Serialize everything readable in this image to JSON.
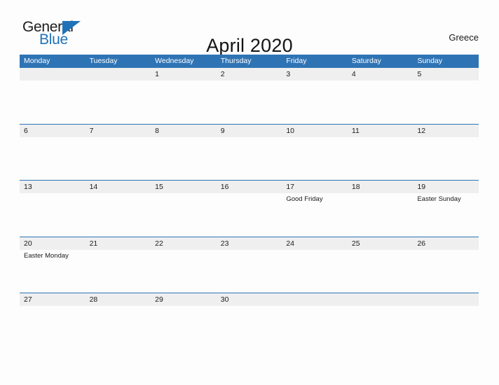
{
  "logo": {
    "word_one": "General",
    "word_two": "Blue",
    "triangle_icon": "triangle-icon",
    "accent_color": "#2072b8"
  },
  "header": {
    "title": "April 2020",
    "country": "Greece"
  },
  "theme": {
    "header_blue": "#2e74b5",
    "band_gray": "#efefef",
    "page_background": "#fdfdfd"
  },
  "calendar": {
    "weekdays": [
      "Monday",
      "Tuesday",
      "Wednesday",
      "Thursday",
      "Friday",
      "Saturday",
      "Sunday"
    ],
    "weeks": [
      [
        {
          "day": "",
          "event": ""
        },
        {
          "day": "",
          "event": ""
        },
        {
          "day": "1",
          "event": ""
        },
        {
          "day": "2",
          "event": ""
        },
        {
          "day": "3",
          "event": ""
        },
        {
          "day": "4",
          "event": ""
        },
        {
          "day": "5",
          "event": ""
        }
      ],
      [
        {
          "day": "6",
          "event": ""
        },
        {
          "day": "7",
          "event": ""
        },
        {
          "day": "8",
          "event": ""
        },
        {
          "day": "9",
          "event": ""
        },
        {
          "day": "10",
          "event": ""
        },
        {
          "day": "11",
          "event": ""
        },
        {
          "day": "12",
          "event": ""
        }
      ],
      [
        {
          "day": "13",
          "event": ""
        },
        {
          "day": "14",
          "event": ""
        },
        {
          "day": "15",
          "event": ""
        },
        {
          "day": "16",
          "event": ""
        },
        {
          "day": "17",
          "event": "Good Friday"
        },
        {
          "day": "18",
          "event": ""
        },
        {
          "day": "19",
          "event": "Easter Sunday"
        }
      ],
      [
        {
          "day": "20",
          "event": "Easter Monday"
        },
        {
          "day": "21",
          "event": ""
        },
        {
          "day": "22",
          "event": ""
        },
        {
          "day": "23",
          "event": ""
        },
        {
          "day": "24",
          "event": ""
        },
        {
          "day": "25",
          "event": ""
        },
        {
          "day": "26",
          "event": ""
        }
      ],
      [
        {
          "day": "27",
          "event": ""
        },
        {
          "day": "28",
          "event": ""
        },
        {
          "day": "29",
          "event": ""
        },
        {
          "day": "30",
          "event": ""
        },
        {
          "day": "",
          "event": ""
        },
        {
          "day": "",
          "event": ""
        },
        {
          "day": "",
          "event": ""
        }
      ]
    ]
  }
}
